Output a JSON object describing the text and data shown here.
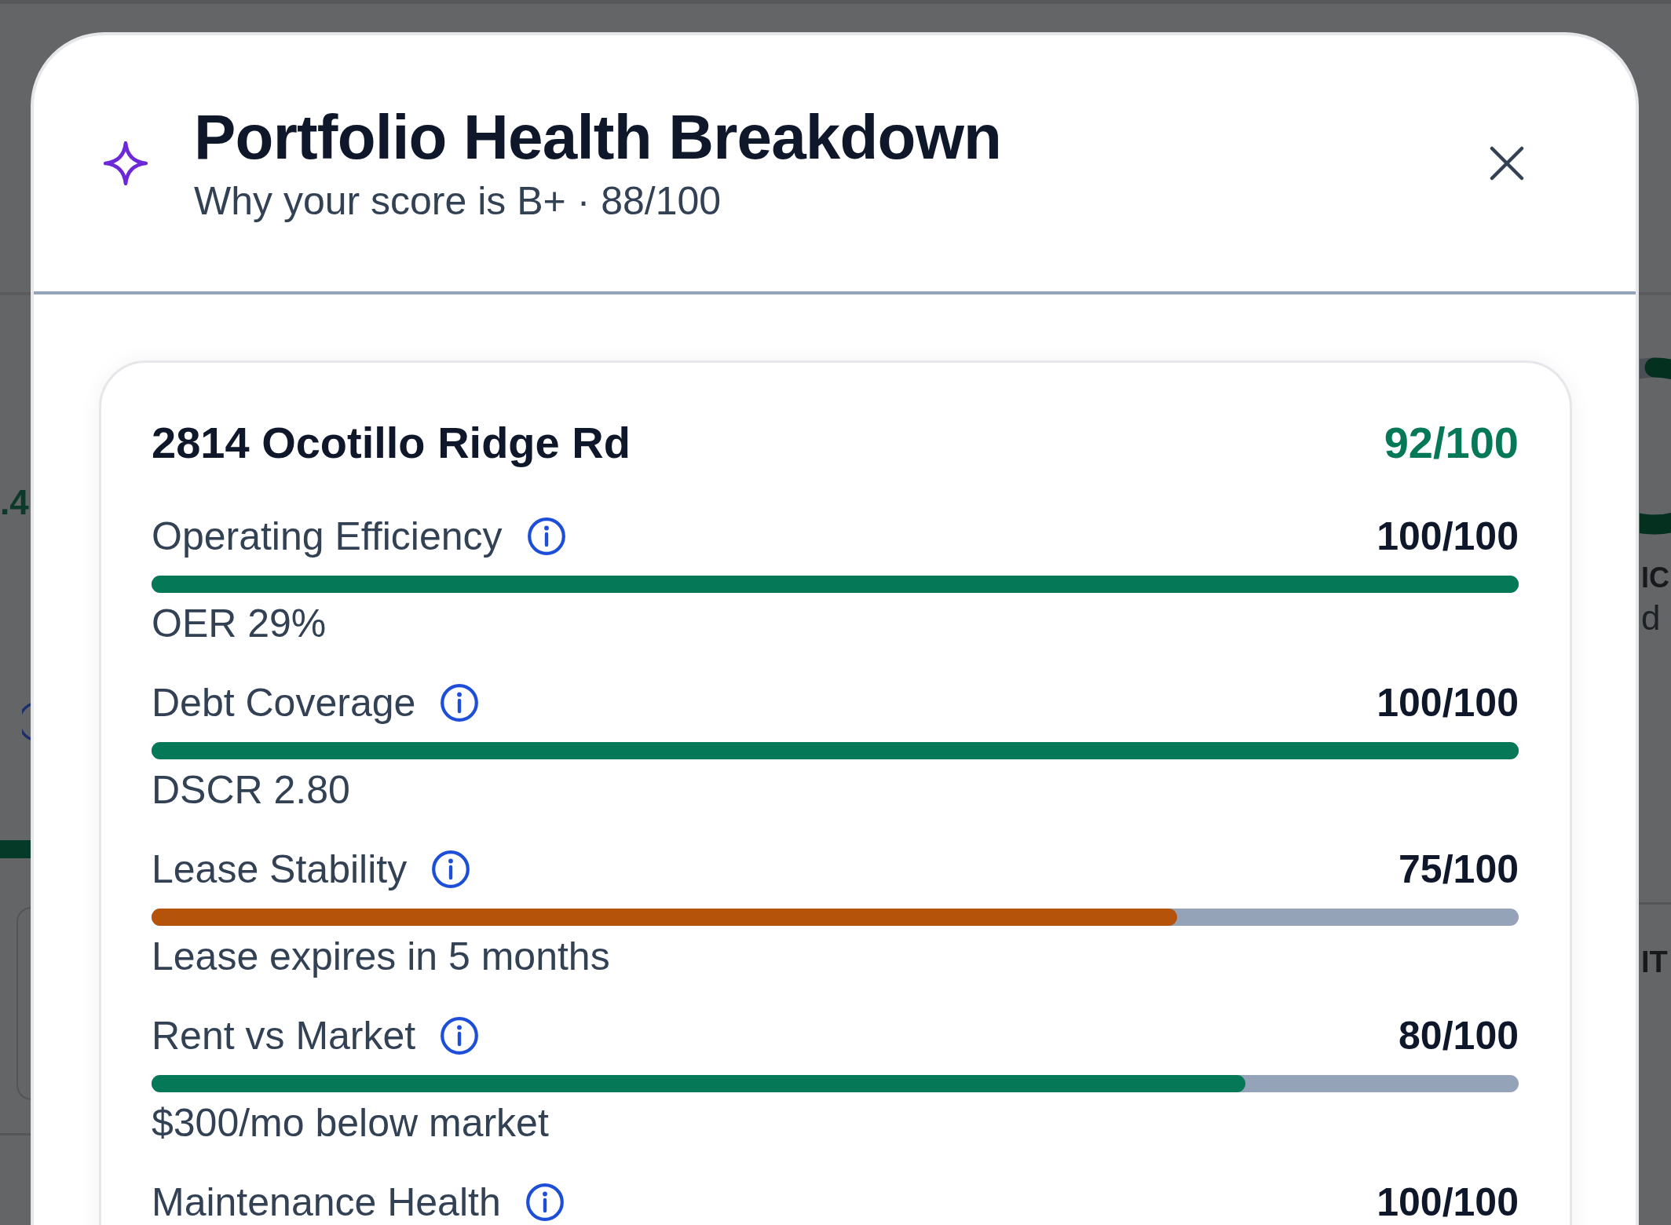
{
  "backdrop": {
    "texts": [
      ".4",
      "IC",
      "d",
      "IT"
    ]
  },
  "dialog": {
    "title": "Portfolio Health Breakdown",
    "subtitle": "Why your score is B+ · 88/100",
    "property": {
      "name": "2814 Ocotillo Ridge Rd",
      "score": "92/100",
      "metrics": [
        {
          "label": "Operating Efficiency",
          "score": "100/100",
          "level": 1,
          "color": "#047857",
          "detail": "OER 29%"
        },
        {
          "label": "Debt Coverage",
          "score": "100/100",
          "level": 1,
          "color": "#047857",
          "detail": "DSCR 2.80"
        },
        {
          "label": "Lease Stability",
          "score": "75/100",
          "level": 0.75,
          "color": "#b45309",
          "detail": "Lease expires in 5 months"
        },
        {
          "label": "Rent vs Market",
          "score": "80/100",
          "level": 0.8,
          "color": "#047857",
          "detail": "$300/mo below market"
        },
        {
          "label": "Maintenance Health",
          "score": "100/100"
        }
      ]
    }
  }
}
